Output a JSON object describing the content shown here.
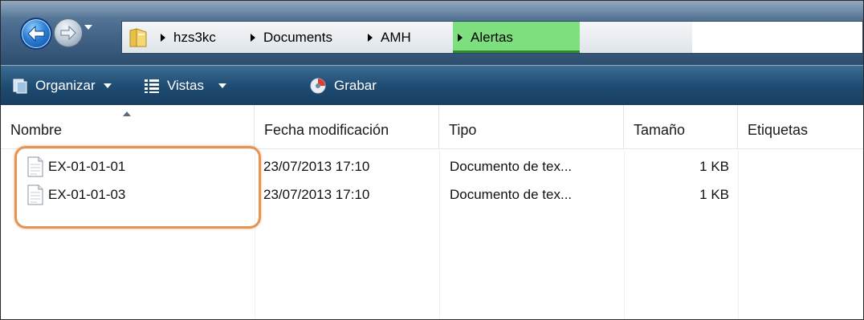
{
  "navigation": {
    "back_icon": "back-arrow-icon",
    "forward_icon": "forward-arrow-icon"
  },
  "address_bar": {
    "folder_icon": "folder-icon",
    "breadcrumbs": [
      {
        "label": "hzs3kc"
      },
      {
        "label": "Documents"
      },
      {
        "label": "AMH"
      },
      {
        "label": "Alertas",
        "highlighted": true
      }
    ],
    "highlight_color": "#7ddf7d"
  },
  "toolbar": {
    "organize_label": "Organizar",
    "views_label": "Vistas",
    "burn_label": "Grabar"
  },
  "file_list": {
    "columns": [
      "Nombre",
      "Fecha modificación",
      "Tipo",
      "Tamaño",
      "Etiquetas"
    ],
    "sorted_by": "Nombre",
    "rows": [
      {
        "name": "EX-01-01-01",
        "modified": "23/07/2013 17:10",
        "type": "Documento de tex...",
        "size": "1 KB",
        "tags": ""
      },
      {
        "name": "EX-01-01-03",
        "modified": "23/07/2013 17:10",
        "type": "Documento de tex...",
        "size": "1 KB",
        "tags": ""
      }
    ],
    "highlight_ring_color": "#e59452"
  }
}
